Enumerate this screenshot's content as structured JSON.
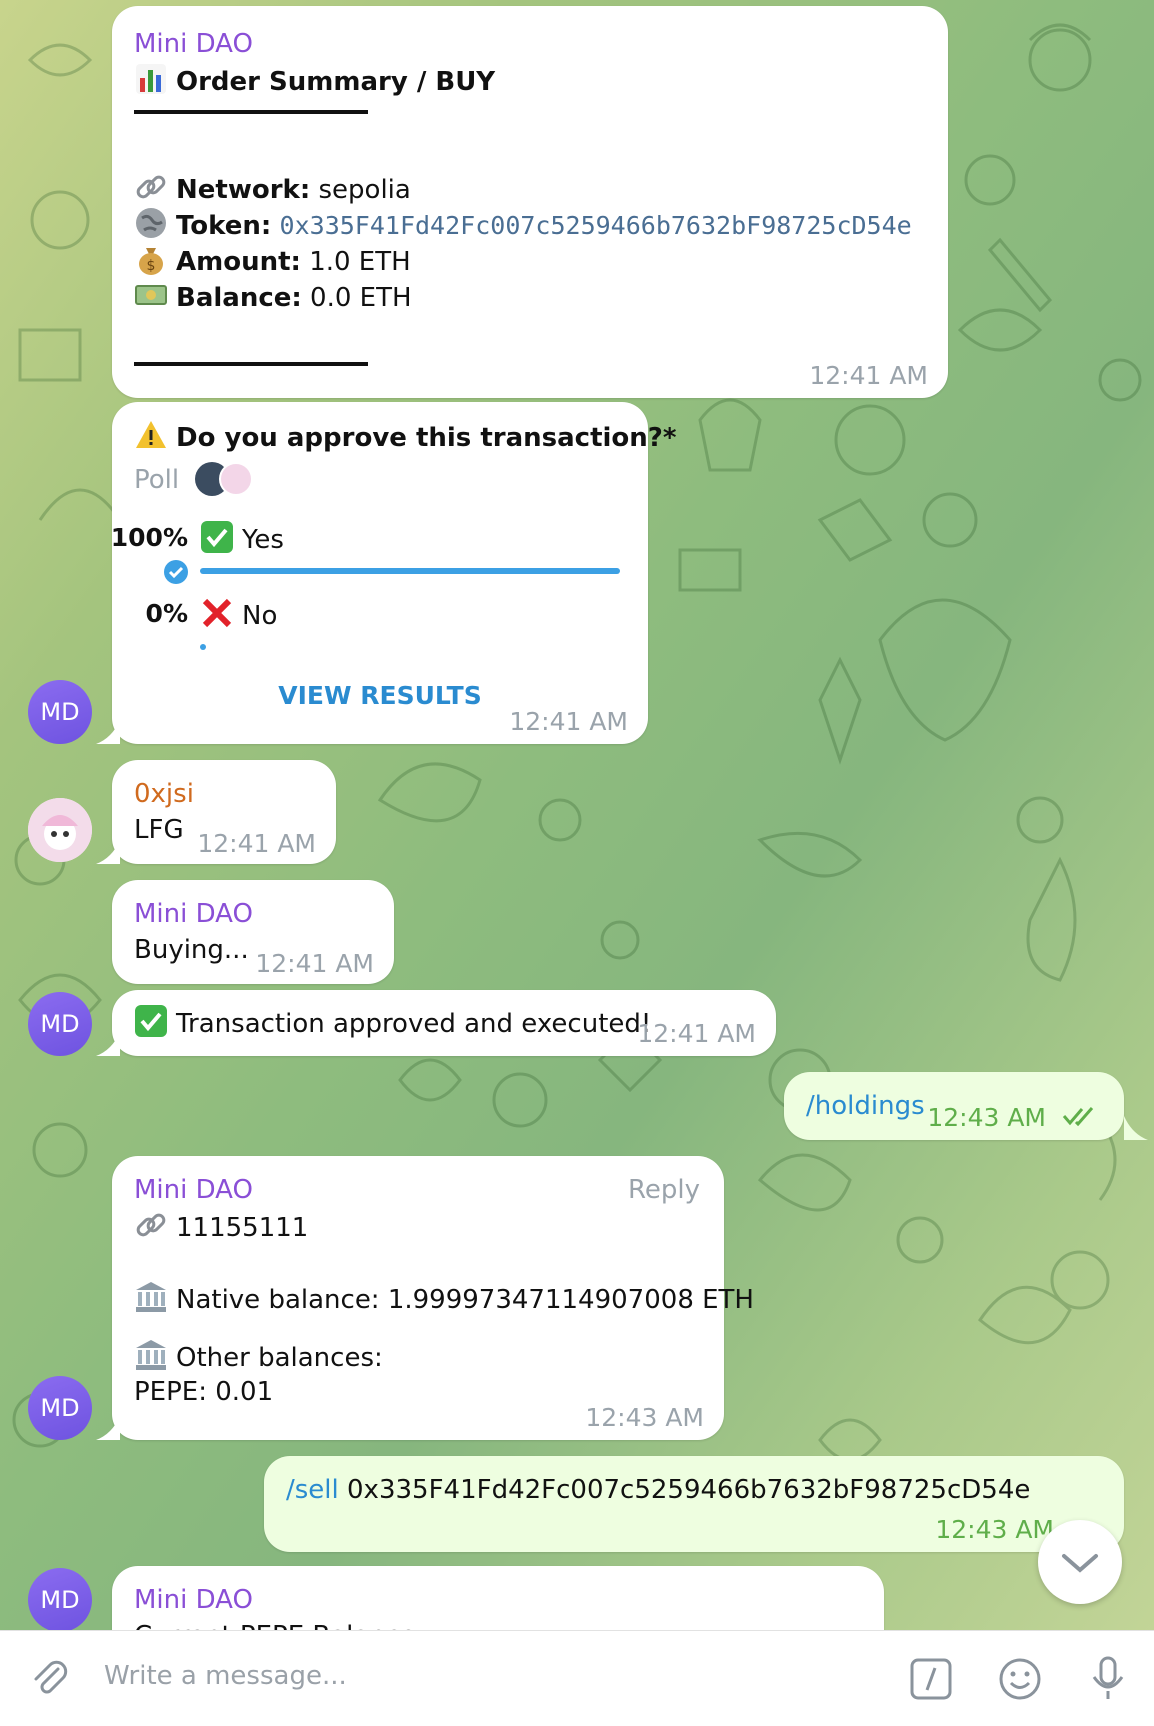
{
  "messages": {
    "order": {
      "sender": "Mini DAO",
      "title": "Order Summary / BUY",
      "network_label": "Network:",
      "network_value": "sepolia",
      "token_label": "Token:",
      "token_value": "0x335F41Fd42Fc007c5259466b7632bF98725cD54e",
      "amount_label": "Amount:",
      "amount_value": "1.0 ETH",
      "balance_label": "Balance:",
      "balance_value": "0.0 ETH",
      "time": "12:41 AM"
    },
    "poll": {
      "question": "Do you approve this transaction?*",
      "kind": "Poll",
      "options": [
        {
          "percent": "100%",
          "label": "Yes",
          "fraction": 1.0
        },
        {
          "percent": "0%",
          "label": "No",
          "fraction": 0.0
        }
      ],
      "view_results": "VIEW RESULTS",
      "time": "12:41 AM",
      "avatar": "MD"
    },
    "lfg": {
      "sender": "0xjsi",
      "text": "LFG",
      "time": "12:41 AM"
    },
    "buying": {
      "sender": "Mini DAO",
      "text": "Buying...",
      "time": "12:41 AM"
    },
    "approved": {
      "text": "Transaction approved and executed!",
      "time": "12:41 AM",
      "avatar": "MD"
    },
    "holdings_cmd": {
      "text": "/holdings",
      "time": "12:43 AM"
    },
    "holdings": {
      "sender": "Mini DAO",
      "reply": "Reply",
      "chain_id": "11155111",
      "native_balance": "Native balance: 1.99997347114907008 ETH",
      "other_label": "Other balances:",
      "pepe": "PEPE: 0.01",
      "time": "12:43 AM",
      "avatar": "MD"
    },
    "sell_cmd": {
      "command": "/sell",
      "arg": "0x335F41Fd42Fc007c5259466b7632bF98725cD54e",
      "time": "12:43 AM"
    },
    "last": {
      "sender": "Mini DAO",
      "partial_text": "Current PEPE Balance",
      "avatar": "MD"
    }
  },
  "composer": {
    "placeholder": "Write a message..."
  },
  "colors": {
    "sender": "#8a4fd6",
    "sender_alt": "#d06a1e",
    "link": "#2a8bd0",
    "poll_bar": "#3ca0e4",
    "out_bubble": "#eefee0",
    "out_time": "#5fae4a",
    "avatar": "#7b5fe8"
  },
  "icons": [
    "link-icon",
    "globe-icon",
    "money-bag-icon",
    "banknote-icon",
    "warning-icon",
    "check-mark-icon",
    "cross-mark-icon",
    "bank-icon",
    "attach-icon",
    "command-icon",
    "emoji-icon",
    "microphone-icon",
    "chevron-down-icon",
    "double-check-icon"
  ]
}
